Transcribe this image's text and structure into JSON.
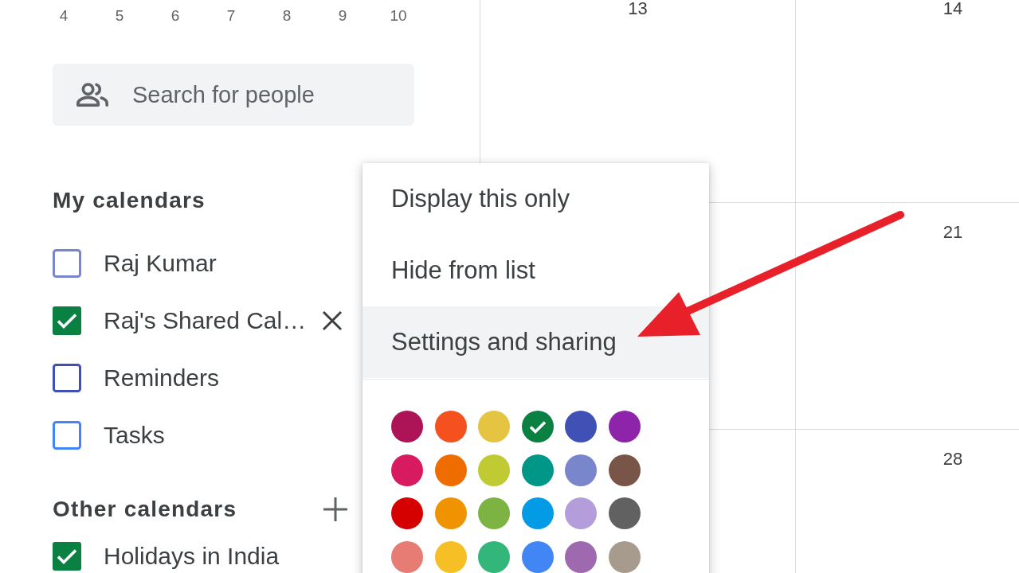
{
  "sidebar": {
    "mini_calendar": {
      "days": [
        "4",
        "5",
        "6",
        "7",
        "8",
        "9",
        "10"
      ]
    },
    "search": {
      "placeholder": "Search for people"
    },
    "my_calendars": {
      "title": "My calendars",
      "items": [
        {
          "label": "Raj Kumar",
          "checked": false,
          "color": "#7986cb",
          "hovered": false
        },
        {
          "label": "Raj's Shared Cal…",
          "checked": true,
          "color": "#0b8043",
          "hovered": true
        },
        {
          "label": "Reminders",
          "checked": false,
          "color": "#3f51b5",
          "hovered": false
        },
        {
          "label": "Tasks",
          "checked": false,
          "color": "#4285f4",
          "hovered": false
        }
      ]
    },
    "other_calendars": {
      "title": "Other calendars",
      "items": [
        {
          "label": "Holidays in India",
          "checked": true,
          "color": "#0b8043",
          "hovered": false
        }
      ]
    }
  },
  "calendar": {
    "weeks": [
      {
        "days": [
          "13",
          "14"
        ]
      },
      {
        "days": [
          "21"
        ]
      },
      {
        "days": [
          "28"
        ]
      }
    ]
  },
  "menu": {
    "items": [
      {
        "label": "Display this only",
        "highlighted": false
      },
      {
        "label": "Hide from list",
        "highlighted": false
      },
      {
        "label": "Settings and sharing",
        "highlighted": true
      }
    ],
    "colors": [
      {
        "color": "#ad1457",
        "selected": false
      },
      {
        "color": "#f4511e",
        "selected": false
      },
      {
        "color": "#e4c441",
        "selected": false
      },
      {
        "color": "#0b8043",
        "selected": true
      },
      {
        "color": "#3f51b5",
        "selected": false
      },
      {
        "color": "#8e24aa",
        "selected": false
      },
      {
        "color": "#d81b60",
        "selected": false
      },
      {
        "color": "#ef6c00",
        "selected": false
      },
      {
        "color": "#c0ca33",
        "selected": false
      },
      {
        "color": "#009688",
        "selected": false
      },
      {
        "color": "#7986cb",
        "selected": false
      },
      {
        "color": "#795548",
        "selected": false
      },
      {
        "color": "#d50000",
        "selected": false
      },
      {
        "color": "#f09300",
        "selected": false
      },
      {
        "color": "#7cb342",
        "selected": false
      },
      {
        "color": "#039be5",
        "selected": false
      },
      {
        "color": "#b39ddb",
        "selected": false
      },
      {
        "color": "#616161",
        "selected": false
      },
      {
        "color": "#e67c73",
        "selected": false
      },
      {
        "color": "#f6bf26",
        "selected": false
      },
      {
        "color": "#33b679",
        "selected": false
      },
      {
        "color": "#4285f4",
        "selected": false
      },
      {
        "color": "#9e69af",
        "selected": false
      },
      {
        "color": "#a79b8e",
        "selected": false
      }
    ]
  }
}
